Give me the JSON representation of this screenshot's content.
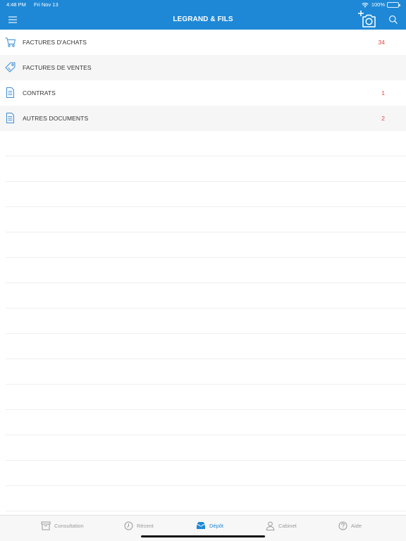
{
  "status_bar": {
    "time": "4:48 PM",
    "date": "Fri Nov 13",
    "battery": "100%",
    "battery_level": 1.0
  },
  "nav": {
    "title": "LEGRAND & FILS"
  },
  "rows": [
    {
      "label": "FACTURES D'ACHATS",
      "count": "34",
      "icon": "cart-icon"
    },
    {
      "label": "FACTURES DE VENTES",
      "count": "",
      "icon": "tag-icon"
    },
    {
      "label": "CONTRATS",
      "count": "1",
      "icon": "document-icon"
    },
    {
      "label": "AUTRES DOCUMENTS",
      "count": "2",
      "icon": "document-icon"
    }
  ],
  "tabs": [
    {
      "label": "Consultation",
      "icon": "archive-box-icon",
      "active": false
    },
    {
      "label": "Récent",
      "icon": "clock-icon",
      "active": false
    },
    {
      "label": "Dépôt",
      "icon": "inbox-tray-icon",
      "active": true
    },
    {
      "label": "Cabinet",
      "icon": "person-icon",
      "active": false
    },
    {
      "label": "Aide",
      "icon": "help-circle-icon",
      "active": false
    }
  ],
  "colors": {
    "accent": "#1e88d6",
    "count": "#e8453c",
    "tab_inactive": "#9a9a9a",
    "row_alt": "#f6f6f6"
  }
}
